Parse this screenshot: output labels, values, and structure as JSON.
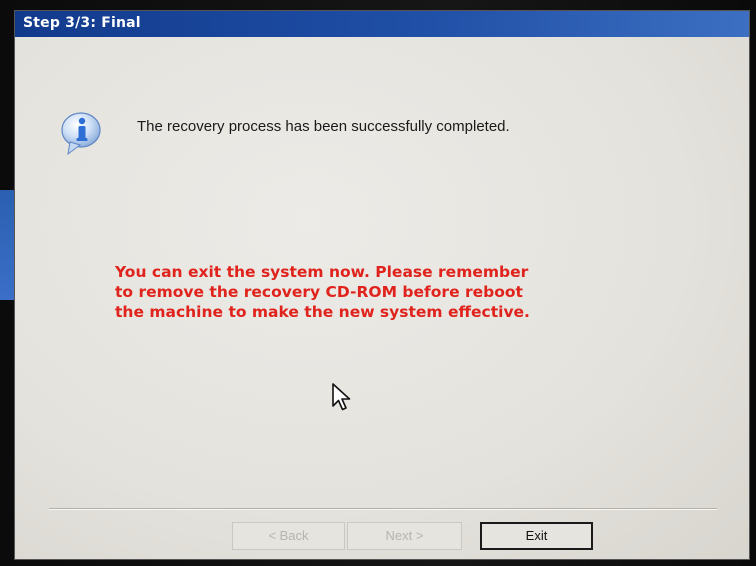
{
  "window": {
    "title": "Step 3/3: Final"
  },
  "message": {
    "icon": "info-icon",
    "text": "The recovery process has been successfully completed."
  },
  "warning": {
    "color": "#e0231c",
    "lines": [
      "You can exit the system now. Please remember",
      "to remove the recovery CD-ROM before reboot",
      "the machine to make the new system effective."
    ]
  },
  "buttons": {
    "back_label": "< Back",
    "next_label": "Next >",
    "exit_label": "Exit"
  },
  "colors": {
    "titlebar": "#1f4fa6",
    "accent": "#2e6fd6"
  }
}
